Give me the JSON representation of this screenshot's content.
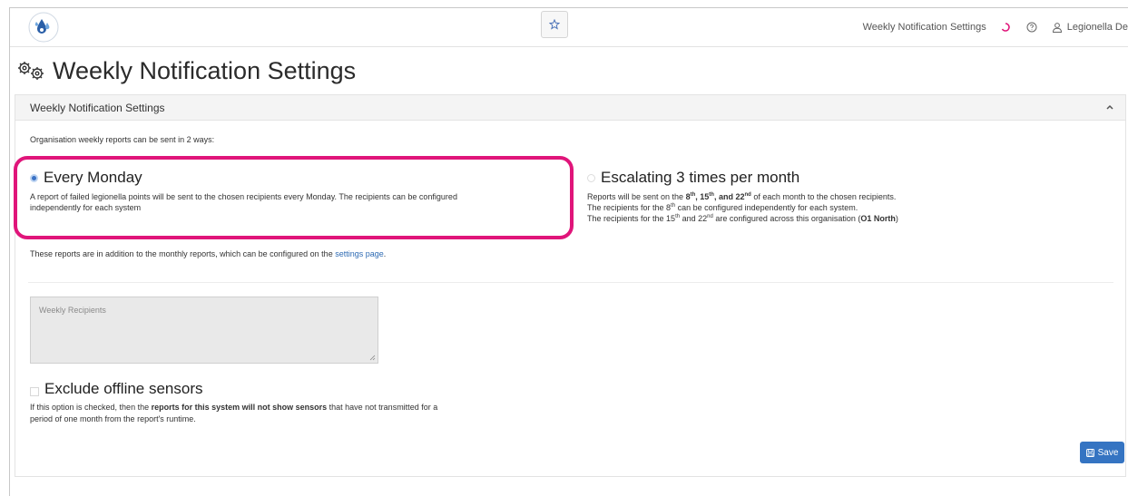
{
  "topbar": {
    "favorite_icon": "star-icon",
    "title": "Weekly Notification Settings",
    "user_name": "Legionella De"
  },
  "page": {
    "title": "Weekly Notification Settings"
  },
  "panel": {
    "header": "Weekly Notification Settings",
    "intro": "Organisation weekly reports can be sent in 2 ways:",
    "monday": {
      "title": "Every Monday",
      "desc_line1": "A report of failed legionella points will be sent to the chosen recipients every Monday. The recipients can be configured",
      "desc_line2": "independently for each system",
      "selected": true
    },
    "escalating": {
      "title": "Escalating 3 times per month",
      "l1_a": "Reports will be sent on the ",
      "d8": "8",
      "d15": "15",
      "d22": "22",
      "th": "th",
      "nd": "nd",
      "comma": ", ",
      "and": ", and ",
      "l1_b": " of each month to the chosen recipients.",
      "l2_a": "The recipients for the ",
      "l2_b": " can be configured independently for each system.",
      "l3_a": "The recipients for the ",
      "l3_and": " and ",
      "l3_b": " are configured across this organisation (",
      "org": "O1 North",
      "l3_c": ")",
      "selected": false
    },
    "addition_text": "These reports are in addition to the monthly reports, which can be configured on the ",
    "settings_link": "settings page",
    "addition_end": ".",
    "recipients_placeholder": "Weekly Recipients",
    "exclude": {
      "title": "Exclude offline sensors",
      "desc_a": "If this option is checked, then the ",
      "desc_bold": "reports for this system will not show sensors",
      "desc_b": " that have not transmitted for a",
      "desc_c": "period of one month from the report's runtime.",
      "checked": false
    },
    "save_label": "Save"
  },
  "colors": {
    "accent": "#3574c2",
    "highlight": "#e0157a"
  }
}
